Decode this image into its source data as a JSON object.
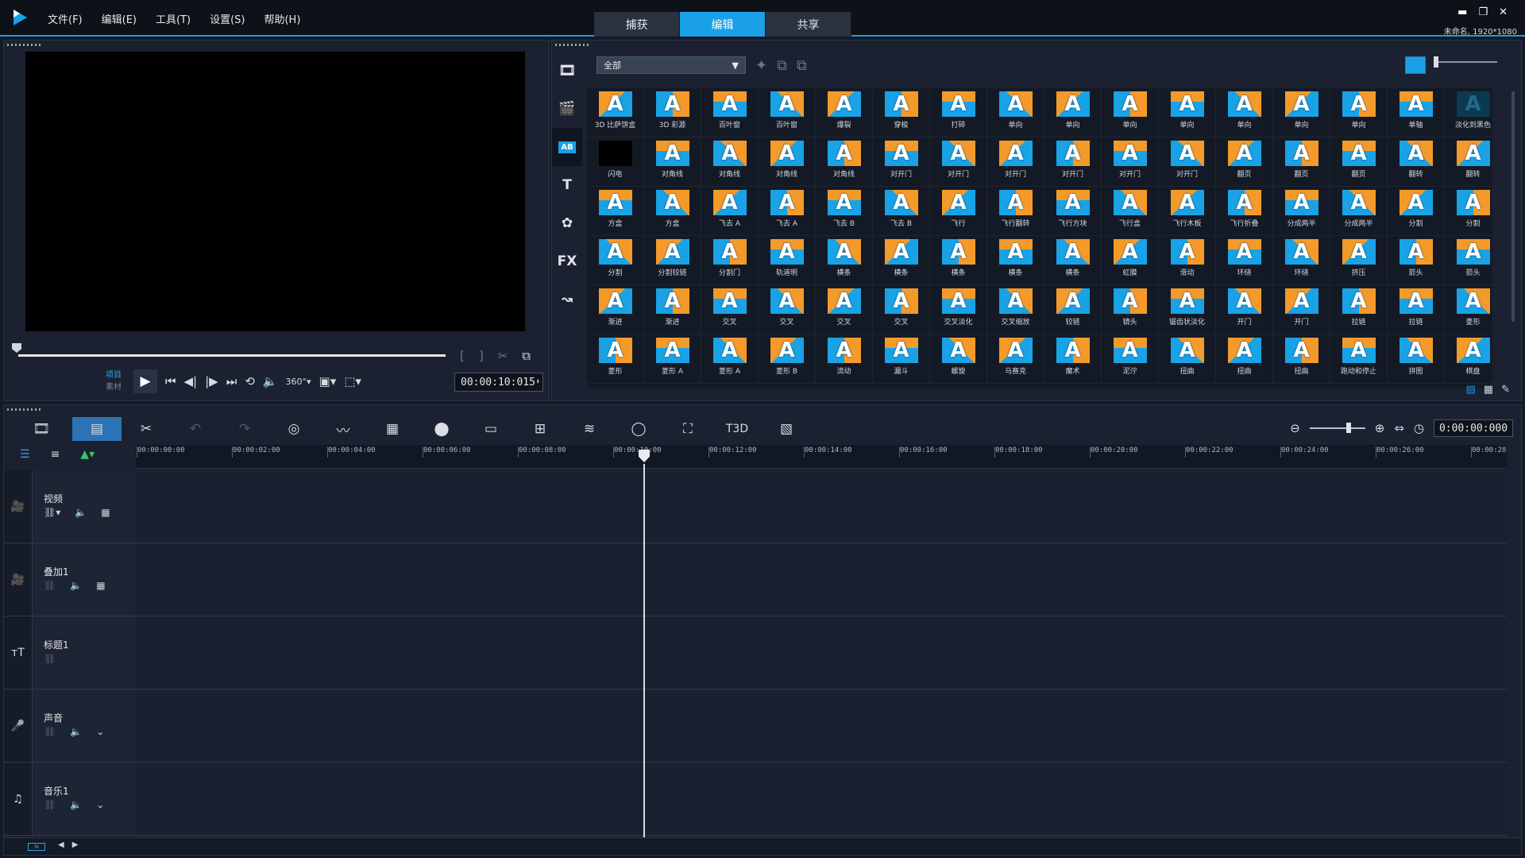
{
  "menu": [
    "文件(F)",
    "编辑(E)",
    "工具(T)",
    "设置(S)",
    "帮助(H)"
  ],
  "tabs": [
    {
      "label": "捕获"
    },
    {
      "label": "编辑",
      "active": true
    },
    {
      "label": "共享"
    }
  ],
  "window": {
    "min": "▬",
    "max": "❐",
    "close": "✕",
    "project_info": "未命名, 1920*1080"
  },
  "preview": {
    "mode_project": "项目",
    "mode_clip": "素材",
    "timecode": "00:00:10:015"
  },
  "library": {
    "filter": "全部",
    "items": [
      [
        "3D 比萨饼盒",
        "3D 彩源",
        "百叶窗",
        "百叶窗",
        "爆裂",
        "穿梭",
        "打碎",
        "单向",
        "单向",
        "单向",
        "单向",
        "单向",
        "单向",
        "单向",
        "单轴",
        "淡化到黑色"
      ],
      [
        "闪电",
        "对角线",
        "对角线",
        "对角线",
        "对角线",
        "对开门",
        "对开门",
        "对开门",
        "对开门",
        "对开门",
        "对开门",
        "翻页",
        "翻页",
        "翻页",
        "翻转",
        "翻转"
      ],
      [
        "方盒",
        "方盒",
        "飞去 A",
        "飞去 A",
        "飞去 B",
        "飞去 B",
        "飞行",
        "飞行翻转",
        "飞行方块",
        "飞行盒",
        "飞行木板",
        "飞行折叠",
        "分成两半",
        "分成两半",
        "分割",
        "分割"
      ],
      [
        "分割",
        "分割铰链",
        "分割门",
        "轨道明",
        "横条",
        "横条",
        "横条",
        "横条",
        "横条",
        "虹膜",
        "滑动",
        "环绕",
        "环绕",
        "挤压",
        "箭头",
        "箭头"
      ],
      [
        "渐进",
        "渐进",
        "交叉",
        "交叉",
        "交叉",
        "交叉",
        "交叉淡化",
        "交叉缩放",
        "铰链",
        "镜头",
        "锯齿状淡化",
        "开门",
        "开门",
        "拉链",
        "拉链",
        "菱形"
      ],
      [
        "菱形",
        "菱形 A",
        "菱形 A",
        "菱形 B",
        "流动",
        "漏斗",
        "螺旋",
        "马赛克",
        "魔术",
        "泥泞",
        "扭曲",
        "扭曲",
        "扭曲",
        "跑动和停止",
        "拼图",
        "棋盘"
      ]
    ]
  },
  "timeline": {
    "timecode": "0:00:00:000",
    "ruler": [
      "00:00:00:00",
      "00:00:02:00",
      "00:00:04:00",
      "00:00:06:00",
      "00:00:08:00",
      "00:00:10:00",
      "00:00:12:00",
      "00:00:14:00",
      "00:00:16:00",
      "00:00:18:00",
      "00:00:20:00",
      "00:00:22:00",
      "00:00:24:00",
      "00:00:26:00",
      "00:00:28"
    ],
    "tracks": [
      {
        "name": "视频",
        "icon": "video-track-icon"
      },
      {
        "name": "叠加1",
        "icon": "overlay-track-icon"
      },
      {
        "name": "标题1",
        "icon": "title-track-icon"
      },
      {
        "name": "声音",
        "icon": "voice-track-icon"
      },
      {
        "name": "音乐1",
        "icon": "music-track-icon"
      }
    ]
  },
  "colors": {
    "accent": "#1aa0e6",
    "background": "#141a26",
    "panel": "#1b2130"
  }
}
